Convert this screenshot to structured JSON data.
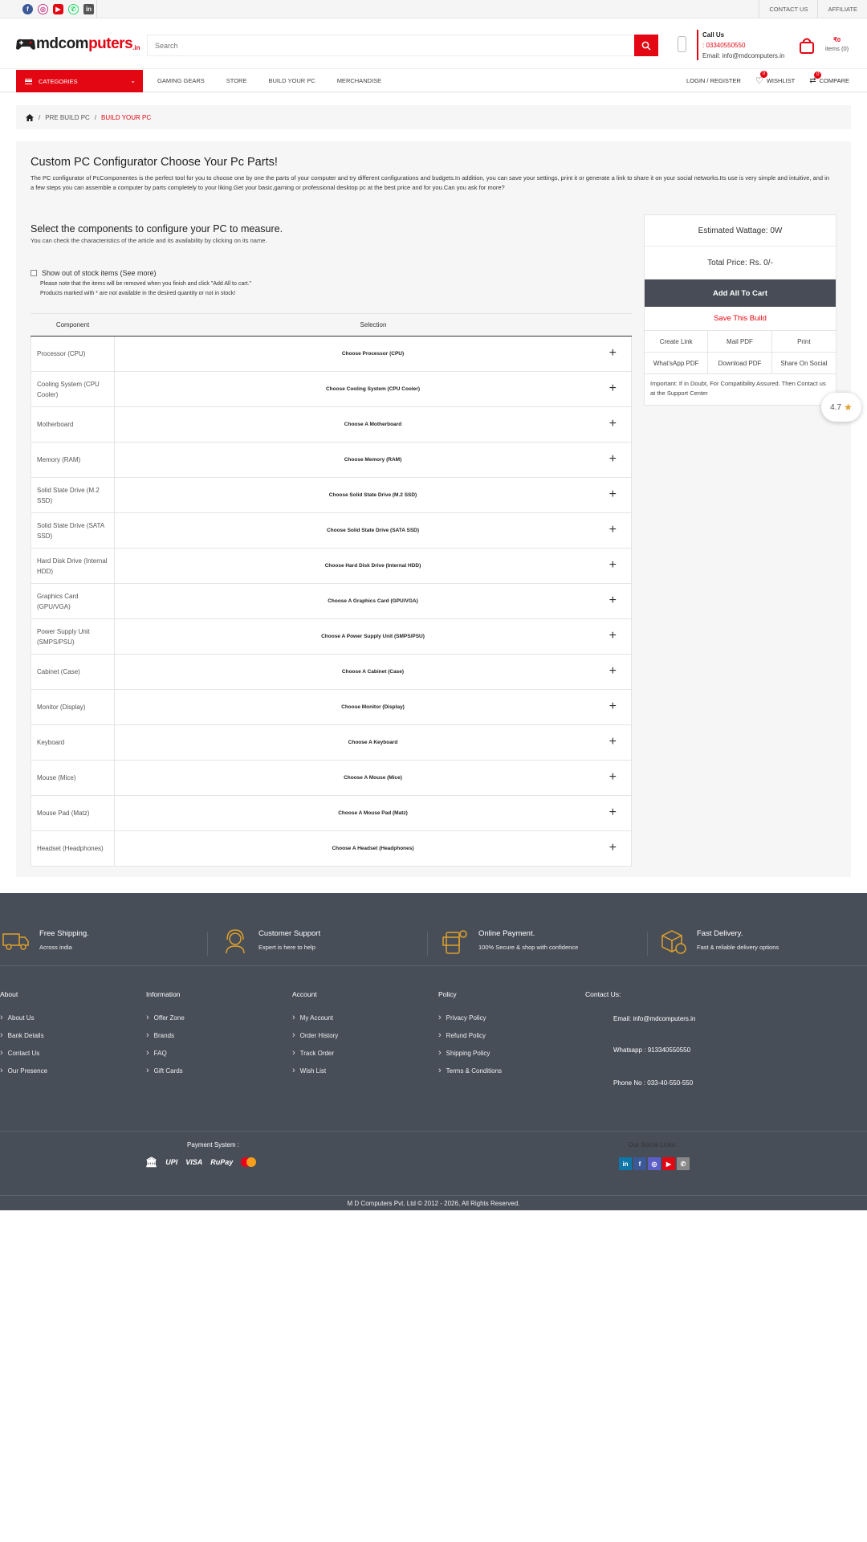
{
  "topbar": {
    "links": [
      "CONTACT US",
      "AFFILIATE"
    ],
    "socials": [
      "facebook-icon",
      "instagram-icon",
      "youtube-icon",
      "whatsapp-icon",
      "linkedin-icon"
    ]
  },
  "header": {
    "logo_main": "mdcom",
    "logo_accent": "puters",
    "logo_tld": ".in",
    "search_placeholder": "Search",
    "call_title": "Call Us",
    "call_number": ": 03340550550",
    "email": "Email: info@mdcomputers.in",
    "cart_amount": "₹0",
    "cart_items": "items (0)"
  },
  "nav": {
    "categories": "CATEGORIES",
    "items": [
      "GAMING GEARS",
      "STORE",
      "BUILD YOUR PC",
      "MERCHANDISE"
    ],
    "login": "LOGIN / REGISTER",
    "wishlist": "WISHLIST",
    "wishlist_count": "0",
    "compare": "COMPARE",
    "compare_count": "0"
  },
  "breadcrumb": {
    "items": [
      "PRE BUILD PC",
      "BUILD YOUR PC"
    ]
  },
  "main": {
    "title": "Custom PC Configurator Choose Your Pc Parts!",
    "intro": "The PC configurator of PcComponentes is the perfect tool for you to choose one by one the parts of your computer and try different configurations and budgets.In addition, you can save your settings, print it or generate a link to share it on your social networks.Its use is very simple and intuitive, and in a few steps you can assemble a computer by parts completely to your liking.Get your basic,gaming or professional desktop pc at the best price and for you.Can you ask for more?",
    "select_title": "Select the components to configure your PC to measure.",
    "select_sub": "You can check the characteristics of the article and its availability by clicking on its name.",
    "stock_label": "Show out of stock items (See more)",
    "note1": "Please note that the items will be removed when you finish and click \"Add All to cart.\"",
    "note2": "Products marked with * are not available in the desired quantity or not in stock!",
    "col_component": "Component",
    "col_selection": "Selection",
    "rows": [
      {
        "name": "Processor (CPU)",
        "choose": "Choose Processor (CPU)"
      },
      {
        "name": "Cooling System (CPU Cooler)",
        "choose": "Choose Cooling System (CPU Cooler)"
      },
      {
        "name": "Motherboard",
        "choose": "Choose A Motherboard"
      },
      {
        "name": "Memory (RAM)",
        "choose": "Choose Memory (RAM)"
      },
      {
        "name": "Solid State Drive (M.2 SSD)",
        "choose": "Choose Solid State Drive (M.2 SSD)"
      },
      {
        "name": "Solid State Drive (SATA SSD)",
        "choose": "Choose Solid State Drive (SATA SSD)"
      },
      {
        "name": "Hard Disk Drive (Internal HDD)",
        "choose": "Choose Hard Disk Drive (Internal HDD)"
      },
      {
        "name": "Graphics Card (GPU/VGA)",
        "choose": "Choose A Graphics Card (GPU/VGA)"
      },
      {
        "name": "Power Supply Unit (SMPS/PSU)",
        "choose": "Choose A Power Supply Unit (SMPS/PSU)"
      },
      {
        "name": "Cabinet (Case)",
        "choose": "Choose A Cabinet (Case)"
      },
      {
        "name": "Monitor (Display)",
        "choose": "Choose Monitor (Display)"
      },
      {
        "name": "Keyboard",
        "choose": "Choose A Keyboard"
      },
      {
        "name": "Mouse (Mice)",
        "choose": "Choose A Mouse (Mice)"
      },
      {
        "name": "Mouse Pad (Matz)",
        "choose": "Choose A Mouse Pad (Matz)"
      },
      {
        "name": "Headset (Headphones)",
        "choose": "Choose A Headset (Headphones)"
      }
    ]
  },
  "summary": {
    "wattage": "Estimated Wattage: 0W",
    "total": "Total Price: Rs. 0/-",
    "add_all": "Add All To Cart",
    "save_build": "Save This Build",
    "actions": [
      "Create Link",
      "Mail PDF",
      "Print",
      "What'sApp PDF",
      "Download PDF",
      "Share On Social"
    ],
    "important": "Important: If in Doubt, For Compatibility Assured. Then Contact us at the Support Center"
  },
  "rating": {
    "value": "4.7"
  },
  "footer": {
    "features": [
      {
        "title": "Free Shipping.",
        "sub": "Across india",
        "icon": "truck-icon"
      },
      {
        "title": "Customer Support",
        "sub": "Expert is here to help",
        "icon": "headset-support-icon"
      },
      {
        "title": "Online Payment.",
        "sub": "100% Secure & shop with confidence",
        "icon": "payment-icon"
      },
      {
        "title": "Fast Delivery.",
        "sub": "Fast & reliable delivery options",
        "icon": "delivery-box-icon"
      }
    ],
    "columns": [
      {
        "title": "About",
        "items": [
          "About Us",
          "Bank Details",
          "Contact Us",
          "Our Presence"
        ]
      },
      {
        "title": "Information",
        "items": [
          "Offer Zone",
          "Brands",
          "FAQ",
          "Gift Cards"
        ]
      },
      {
        "title": "Account",
        "items": [
          "My Account",
          "Order History",
          "Track Order",
          "Wish List"
        ]
      },
      {
        "title": "Policy",
        "items": [
          "Privacy Policy",
          "Refund Policy",
          "Shipping Policy",
          "Terms & Conditions"
        ]
      }
    ],
    "contact_title": "Contact Us:",
    "contact_email": "Email: info@mdcomputers.in",
    "contact_whatsapp": "Whatsapp : 913340550550",
    "contact_phone": "Phone No : 033-40-550-550",
    "payment_title": "Payment System :",
    "payment_methods": [
      "UPI",
      "VISA",
      "RuPay"
    ],
    "social_title": "Our Social Links :",
    "copyright": "M D Computers Pvt. Ltd © 2012 - 2026, All Rights Reserved."
  },
  "colors": {
    "accent": "#e30613",
    "footer": "#484e58",
    "button_dark": "#474c56",
    "icon_gold": "#e0a02a"
  }
}
